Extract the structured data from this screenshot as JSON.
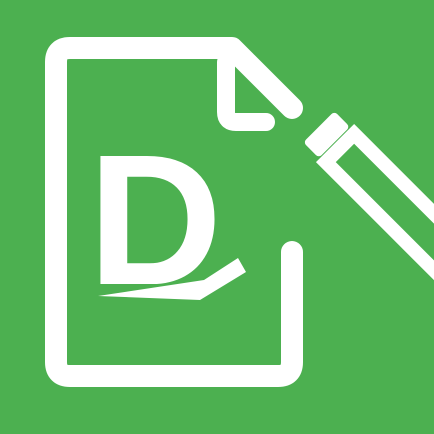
{
  "icon": {
    "name": "document-edit-icon",
    "letter": "D",
    "colors": {
      "background": "#4cb050",
      "foreground": "#ffffff"
    }
  }
}
